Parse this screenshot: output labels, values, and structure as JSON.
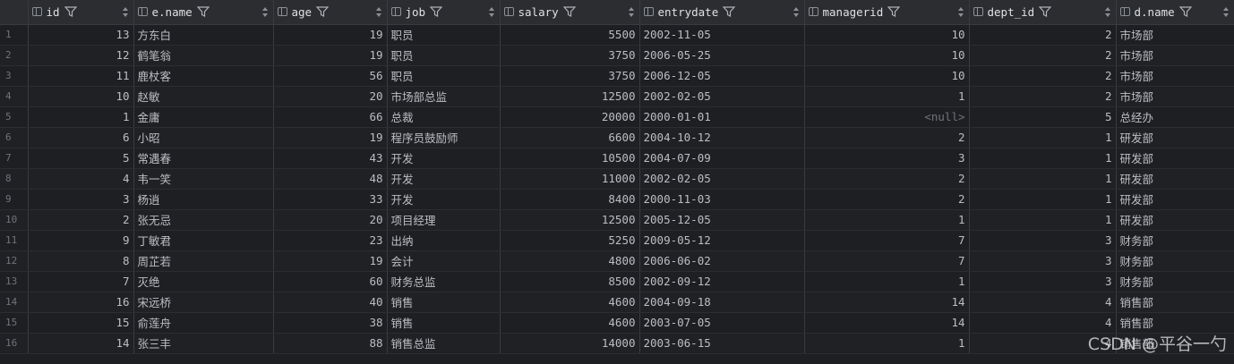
{
  "columns": [
    "id",
    "e.name",
    "age",
    "job",
    "salary",
    "entrydate",
    "managerid",
    "dept_id",
    "d.name"
  ],
  "rows": [
    {
      "n": "1",
      "id": "13",
      "name": "方东白",
      "age": "19",
      "job": "职员",
      "salary": "5500",
      "entrydate": "2002-11-05",
      "managerid": "10",
      "dept_id": "2",
      "dname": "市场部"
    },
    {
      "n": "2",
      "id": "12",
      "name": "鹤笔翁",
      "age": "19",
      "job": "职员",
      "salary": "3750",
      "entrydate": "2006-05-25",
      "managerid": "10",
      "dept_id": "2",
      "dname": "市场部"
    },
    {
      "n": "3",
      "id": "11",
      "name": "鹿杖客",
      "age": "56",
      "job": "职员",
      "salary": "3750",
      "entrydate": "2006-12-05",
      "managerid": "10",
      "dept_id": "2",
      "dname": "市场部"
    },
    {
      "n": "4",
      "id": "10",
      "name": "赵敏",
      "age": "20",
      "job": "市场部总监",
      "salary": "12500",
      "entrydate": "2002-02-05",
      "managerid": "1",
      "dept_id": "2",
      "dname": "市场部"
    },
    {
      "n": "5",
      "id": "1",
      "name": "金庸",
      "age": "66",
      "job": "总裁",
      "salary": "20000",
      "entrydate": "2000-01-01",
      "managerid": "<null>",
      "dept_id": "5",
      "dname": "总经办"
    },
    {
      "n": "6",
      "id": "6",
      "name": "小昭",
      "age": "19",
      "job": "程序员鼓励师",
      "salary": "6600",
      "entrydate": "2004-10-12",
      "managerid": "2",
      "dept_id": "1",
      "dname": "研发部"
    },
    {
      "n": "7",
      "id": "5",
      "name": "常遇春",
      "age": "43",
      "job": "开发",
      "salary": "10500",
      "entrydate": "2004-07-09",
      "managerid": "3",
      "dept_id": "1",
      "dname": "研发部"
    },
    {
      "n": "8",
      "id": "4",
      "name": "韦一笑",
      "age": "48",
      "job": "开发",
      "salary": "11000",
      "entrydate": "2002-02-05",
      "managerid": "2",
      "dept_id": "1",
      "dname": "研发部"
    },
    {
      "n": "9",
      "id": "3",
      "name": "杨逍",
      "age": "33",
      "job": "开发",
      "salary": "8400",
      "entrydate": "2000-11-03",
      "managerid": "2",
      "dept_id": "1",
      "dname": "研发部"
    },
    {
      "n": "10",
      "id": "2",
      "name": "张无忌",
      "age": "20",
      "job": "项目经理",
      "salary": "12500",
      "entrydate": "2005-12-05",
      "managerid": "1",
      "dept_id": "1",
      "dname": "研发部"
    },
    {
      "n": "11",
      "id": "9",
      "name": "丁敏君",
      "age": "23",
      "job": "出纳",
      "salary": "5250",
      "entrydate": "2009-05-12",
      "managerid": "7",
      "dept_id": "3",
      "dname": "财务部"
    },
    {
      "n": "12",
      "id": "8",
      "name": "周芷若",
      "age": "19",
      "job": "会计",
      "salary": "4800",
      "entrydate": "2006-06-02",
      "managerid": "7",
      "dept_id": "3",
      "dname": "财务部"
    },
    {
      "n": "13",
      "id": "7",
      "name": "灭绝",
      "age": "60",
      "job": "财务总监",
      "salary": "8500",
      "entrydate": "2002-09-12",
      "managerid": "1",
      "dept_id": "3",
      "dname": "财务部"
    },
    {
      "n": "14",
      "id": "16",
      "name": "宋远桥",
      "age": "40",
      "job": "销售",
      "salary": "4600",
      "entrydate": "2004-09-18",
      "managerid": "14",
      "dept_id": "4",
      "dname": "销售部"
    },
    {
      "n": "15",
      "id": "15",
      "name": "俞莲舟",
      "age": "38",
      "job": "销售",
      "salary": "4600",
      "entrydate": "2003-07-05",
      "managerid": "14",
      "dept_id": "4",
      "dname": "销售部"
    },
    {
      "n": "16",
      "id": "14",
      "name": "张三丰",
      "age": "88",
      "job": "销售总监",
      "salary": "14000",
      "entrydate": "2003-06-15",
      "managerid": "1",
      "dept_id": "4",
      "dname": "销售部"
    }
  ],
  "watermark": "CSDN @平谷一勺",
  "colors": {
    "background": "#1e1f22",
    "header": "#2b2d30",
    "null_text": "#6f737a"
  }
}
